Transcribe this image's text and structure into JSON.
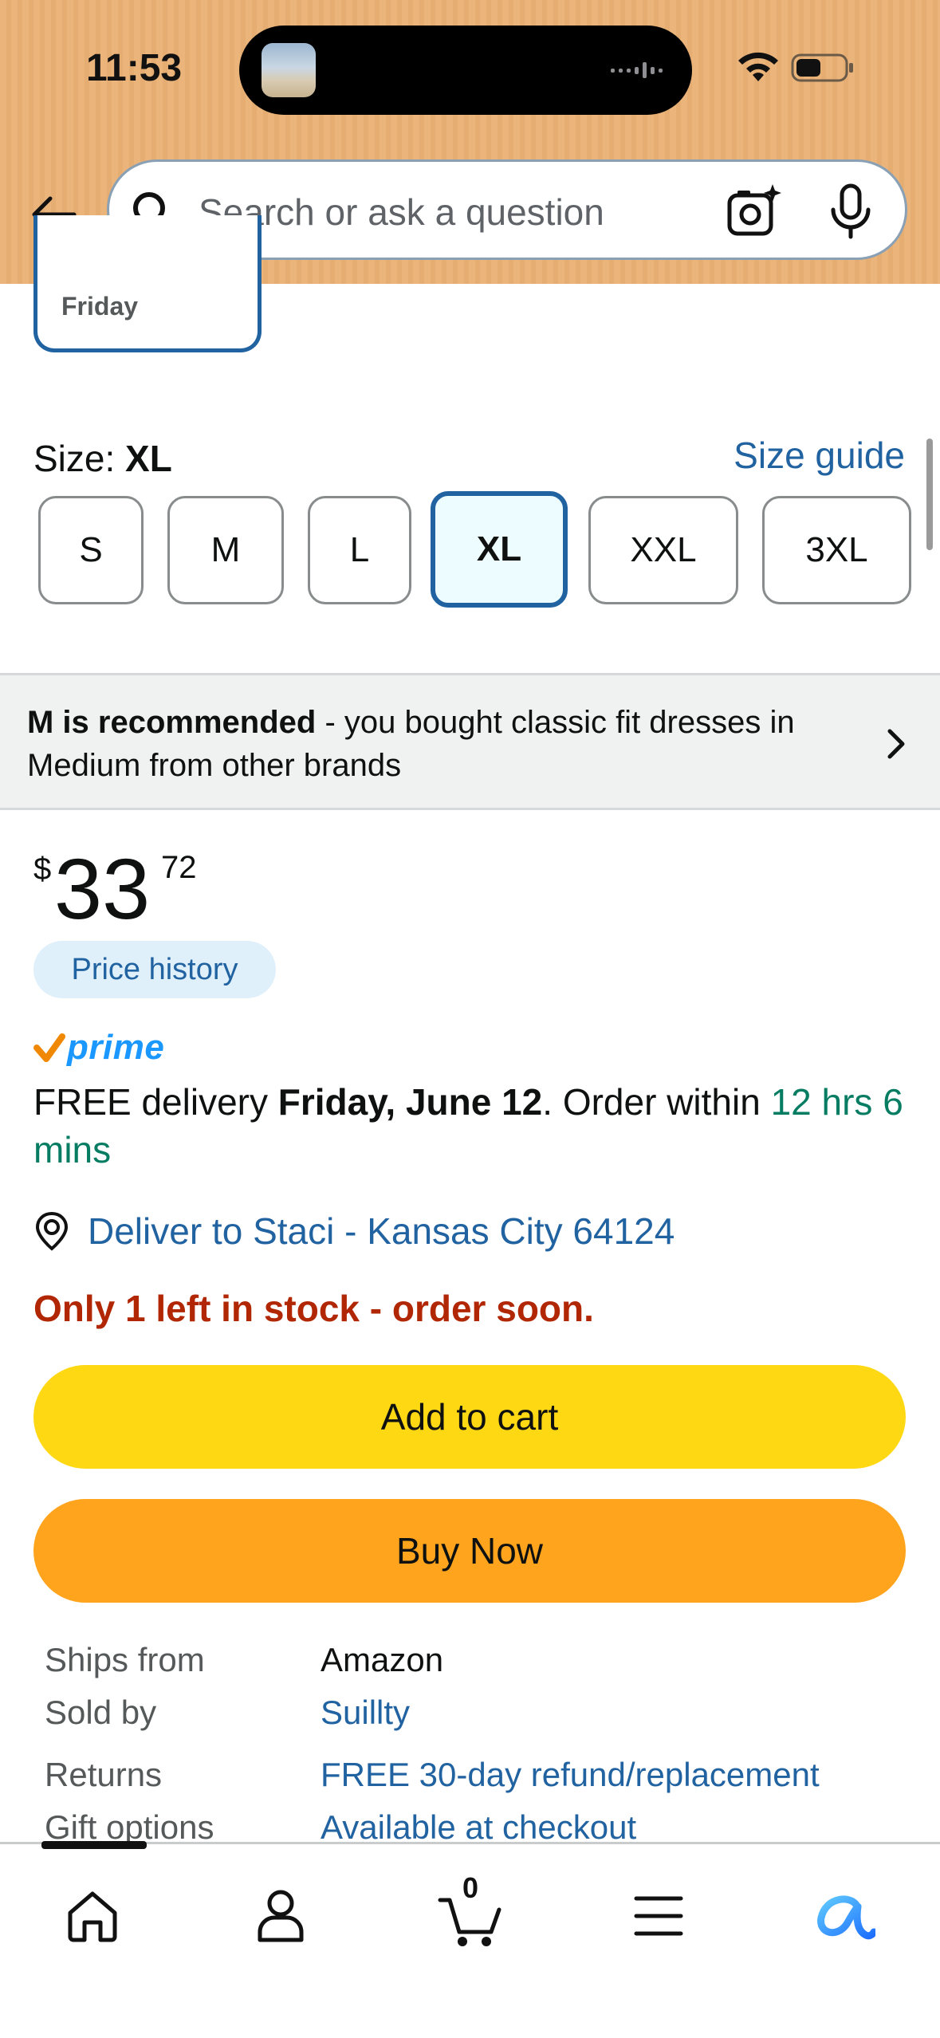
{
  "status_bar": {
    "time": "11:53"
  },
  "header": {
    "search_placeholder": "Search or ask a question",
    "background_color": "#eab47a"
  },
  "delivery_option": {
    "day": "Friday"
  },
  "size": {
    "label": "Size:",
    "selected": "XL",
    "guide_label": "Size guide",
    "options": [
      "S",
      "M",
      "L",
      "XL",
      "XXL",
      "3XL"
    ]
  },
  "recommendation": {
    "bold": "M is recommended",
    "rest": " - you bought classic fit dresses in Medium from other brands"
  },
  "price": {
    "symbol": "$",
    "whole": "33",
    "fraction": "72",
    "history_label": "Price history"
  },
  "prime": {
    "label": "prime"
  },
  "delivery": {
    "prefix": "FREE delivery ",
    "date": "Friday, June 12",
    "middle": ". Order within ",
    "countdown": "12 hrs 6 mins"
  },
  "location": {
    "text": "Deliver to Staci - Kansas City 64124"
  },
  "stock": {
    "text": "Only 1 left in stock - order soon."
  },
  "actions": {
    "add_to_cart": "Add to cart",
    "buy_now": "Buy Now"
  },
  "details": [
    {
      "key": "Ships from",
      "value": "Amazon"
    },
    {
      "key": "Sold by",
      "value": "Suillty"
    },
    {
      "key": "Returns",
      "value": "FREE 30-day refund/replacement"
    },
    {
      "key": "Gift options",
      "value": "Available at checkout"
    }
  ],
  "tab_bar": {
    "cart_count": "0",
    "items": [
      "home-icon",
      "account-icon",
      "cart-icon",
      "menu-icon",
      "rufus-icon"
    ]
  },
  "colors": {
    "link": "#2162a1",
    "add_to_cart": "#ffd814",
    "buy_now": "#ffa41c",
    "stock_warning": "#b12704",
    "countdown": "#067d62"
  }
}
